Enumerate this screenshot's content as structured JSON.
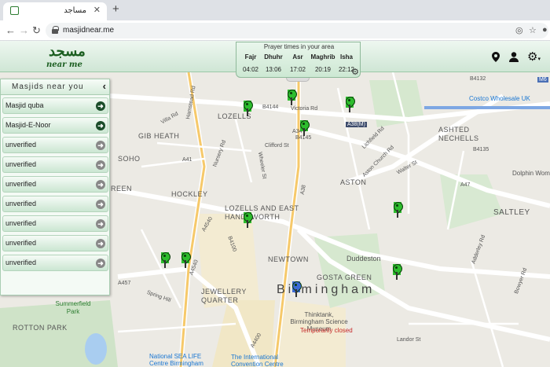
{
  "browser": {
    "tab_title": "مساجد",
    "url": "masjidnear.me"
  },
  "app": {
    "logo_arabic": "مسجد",
    "logo_text": "near me"
  },
  "prayer": {
    "title": "Prayer times in your area",
    "times": [
      {
        "name": "Fajr",
        "time": "04:02"
      },
      {
        "name": "Dhuhr",
        "time": "13:06"
      },
      {
        "name": "Asr",
        "time": "17:02"
      },
      {
        "name": "Maghrib",
        "time": "20:19"
      },
      {
        "name": "Isha",
        "time": "22:12"
      }
    ]
  },
  "sidebar": {
    "title": "Masjids near you",
    "items": [
      {
        "label": "Masjid quba",
        "status": "verified"
      },
      {
        "label": "Masjid-E-Noor",
        "status": "verified"
      },
      {
        "label": "unverified",
        "status": "unverified"
      },
      {
        "label": "unverified",
        "status": "unverified"
      },
      {
        "label": "unverified",
        "status": "unverified"
      },
      {
        "label": "unverified",
        "status": "unverified"
      },
      {
        "label": "unverified",
        "status": "unverified"
      },
      {
        "label": "unverified",
        "status": "unverified"
      },
      {
        "label": "unverified",
        "status": "unverified"
      }
    ]
  },
  "map": {
    "areas": [
      "LOZELLS",
      "GIB HEATH",
      "SOHO",
      "HOCKLEY",
      "LOZELLS AND EAST HANDSWORTH",
      "ASTON",
      "ASHTED NECHELLS",
      "SALTLEY",
      "NEWTOWN",
      "GOSTA GREEN",
      "Duddeston",
      "JEWELLERY QUARTER",
      "ROTTON PARK",
      "Summerfield Park",
      "REEN"
    ],
    "city": "Birmingham",
    "pois": [
      "Costco Wholesale UK",
      "Dolphin Women",
      "Thinktank, Birmingham Science Museum",
      "Temporarily closed",
      "National SEA LIFE Centre Birmingham",
      "The International Convention Centre"
    ],
    "roads": [
      "A34",
      "A4540",
      "A41",
      "B4144",
      "B4132",
      "A38(M)",
      "A457",
      "A4540",
      "B4100",
      "A4400",
      "M6",
      "A47",
      "A38",
      "B4145",
      "B4135"
    ],
    "streets": [
      "Villa Rd",
      "Hamstead Rd",
      "Clifford St",
      "Nursery Rd",
      "Wheeler St",
      "Victoria Rd",
      "Lichfield Rd",
      "Aston Church Rd",
      "Walter St",
      "Spring Hill",
      "Adderley Rd",
      "Landor St",
      "Bowyer Rd"
    ]
  }
}
